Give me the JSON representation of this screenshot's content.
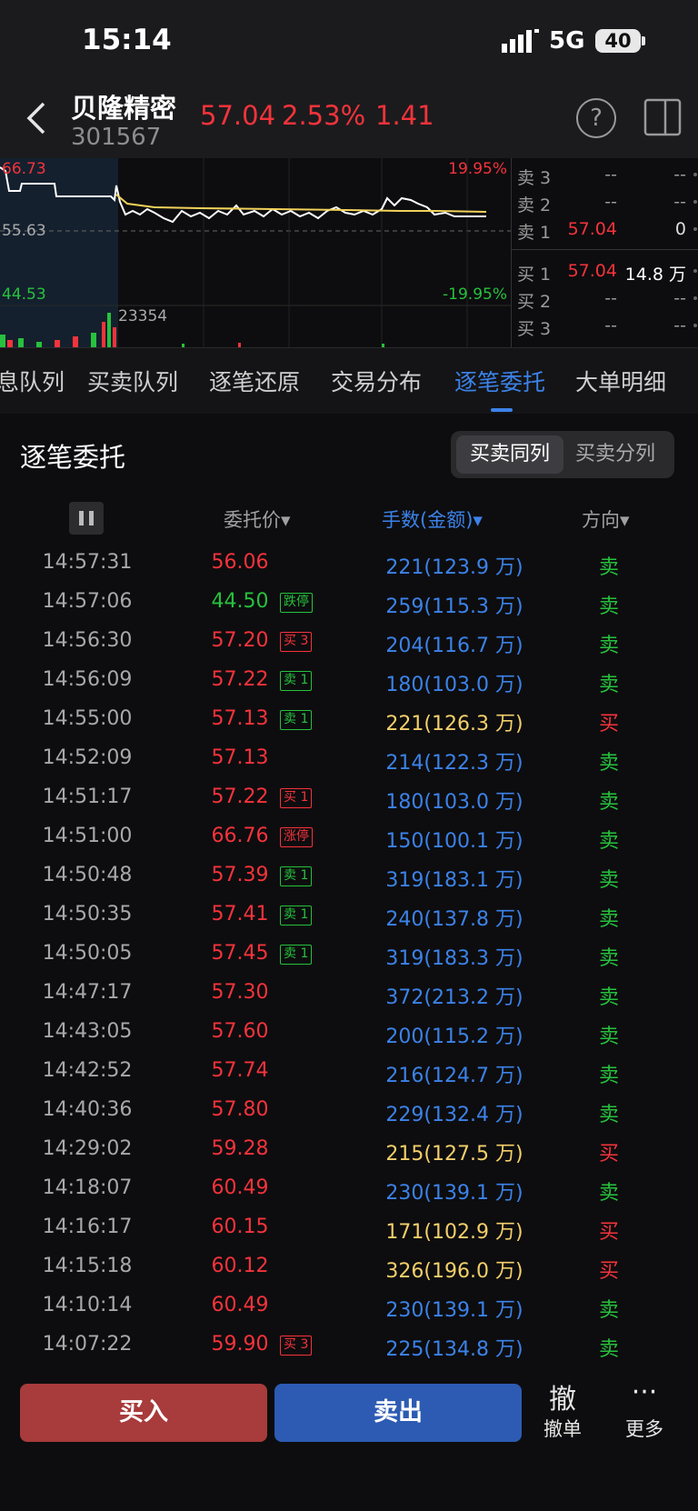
{
  "status": {
    "time": "15:14",
    "network": "5G",
    "battery": "40"
  },
  "header": {
    "name": "贝隆精密",
    "code": "301567",
    "price": "57.04",
    "change_pct": "2.53%",
    "change": "1.41",
    "help_icon": "question-circle-icon",
    "layout_icon": "split-view-icon"
  },
  "chart": {
    "high_label": "66.73",
    "mid_label": "55.63",
    "low_label": "44.53",
    "up_pct": "19.95%",
    "down_pct": "-19.95%",
    "volume_label": "23354"
  },
  "order_book": {
    "asks": [
      {
        "label": "卖 3",
        "price": "--",
        "vol": "--"
      },
      {
        "label": "卖 2",
        "price": "--",
        "vol": "--"
      },
      {
        "label": "卖 1",
        "price": "57.04",
        "vol": "0"
      }
    ],
    "bids": [
      {
        "label": "买 1",
        "price": "57.04",
        "vol": "14.8 万"
      },
      {
        "label": "买 2",
        "price": "--",
        "vol": "--"
      },
      {
        "label": "买 3",
        "price": "--",
        "vol": "--"
      }
    ]
  },
  "tabs": [
    "息队列",
    "买卖队列",
    "逐笔还原",
    "交易分布",
    "逐笔委托",
    "大单明细"
  ],
  "section": {
    "title": "逐笔委托",
    "toggle": [
      "买卖同列",
      "买卖分列"
    ]
  },
  "columns": {
    "price": "委托价▾",
    "volume": "手数(金额)▾",
    "direction": "方向▾"
  },
  "rows": [
    {
      "time": "14:57:31",
      "price": "56.06",
      "tag": "",
      "vol": "221(123.9 万)",
      "dir": "卖"
    },
    {
      "time": "14:57:06",
      "price": "44.50",
      "tag": "跌停",
      "vol": "259(115.3 万)",
      "dir": "卖"
    },
    {
      "time": "14:56:30",
      "price": "57.20",
      "tag": "买 3",
      "vol": "204(116.7 万)",
      "dir": "卖"
    },
    {
      "time": "14:56:09",
      "price": "57.22",
      "tag": "卖 1",
      "vol": "180(103.0 万)",
      "dir": "卖"
    },
    {
      "time": "14:55:00",
      "price": "57.13",
      "tag": "卖 1",
      "vol": "221(126.3 万)",
      "dir": "买"
    },
    {
      "time": "14:52:09",
      "price": "57.13",
      "tag": "",
      "vol": "214(122.3 万)",
      "dir": "卖"
    },
    {
      "time": "14:51:17",
      "price": "57.22",
      "tag": "买 1",
      "vol": "180(103.0 万)",
      "dir": "卖"
    },
    {
      "time": "14:51:00",
      "price": "66.76",
      "tag": "涨停",
      "vol": "150(100.1 万)",
      "dir": "卖"
    },
    {
      "time": "14:50:48",
      "price": "57.39",
      "tag": "卖 1",
      "vol": "319(183.1 万)",
      "dir": "卖"
    },
    {
      "time": "14:50:35",
      "price": "57.41",
      "tag": "卖 1",
      "vol": "240(137.8 万)",
      "dir": "卖"
    },
    {
      "time": "14:50:05",
      "price": "57.45",
      "tag": "卖 1",
      "vol": "319(183.3 万)",
      "dir": "卖"
    },
    {
      "time": "14:47:17",
      "price": "57.30",
      "tag": "",
      "vol": "372(213.2 万)",
      "dir": "卖"
    },
    {
      "time": "14:43:05",
      "price": "57.60",
      "tag": "",
      "vol": "200(115.2 万)",
      "dir": "卖"
    },
    {
      "time": "14:42:52",
      "price": "57.74",
      "tag": "",
      "vol": "216(124.7 万)",
      "dir": "卖"
    },
    {
      "time": "14:40:36",
      "price": "57.80",
      "tag": "",
      "vol": "229(132.4 万)",
      "dir": "卖"
    },
    {
      "time": "14:29:02",
      "price": "59.28",
      "tag": "",
      "vol": "215(127.5 万)",
      "dir": "买"
    },
    {
      "time": "14:18:07",
      "price": "60.49",
      "tag": "",
      "vol": "230(139.1 万)",
      "dir": "卖"
    },
    {
      "time": "14:16:17",
      "price": "60.15",
      "tag": "",
      "vol": "171(102.9 万)",
      "dir": "买"
    },
    {
      "time": "14:15:18",
      "price": "60.12",
      "tag": "",
      "vol": "326(196.0 万)",
      "dir": "买"
    },
    {
      "time": "14:10:14",
      "price": "60.49",
      "tag": "",
      "vol": "230(139.1 万)",
      "dir": "卖"
    },
    {
      "time": "14:07:22",
      "price": "59.90",
      "tag": "买 3",
      "vol": "225(134.8 万)",
      "dir": "卖"
    }
  ],
  "bottom": {
    "buy": "买入",
    "sell": "卖出",
    "cancel_icon": "撤",
    "cancel": "撤单",
    "more_icon": "···",
    "more": "更多"
  },
  "colors": {
    "red": "#f5333b",
    "green": "#27c13d",
    "blue": "#3c82e8",
    "yellow": "#f3cf6a"
  }
}
